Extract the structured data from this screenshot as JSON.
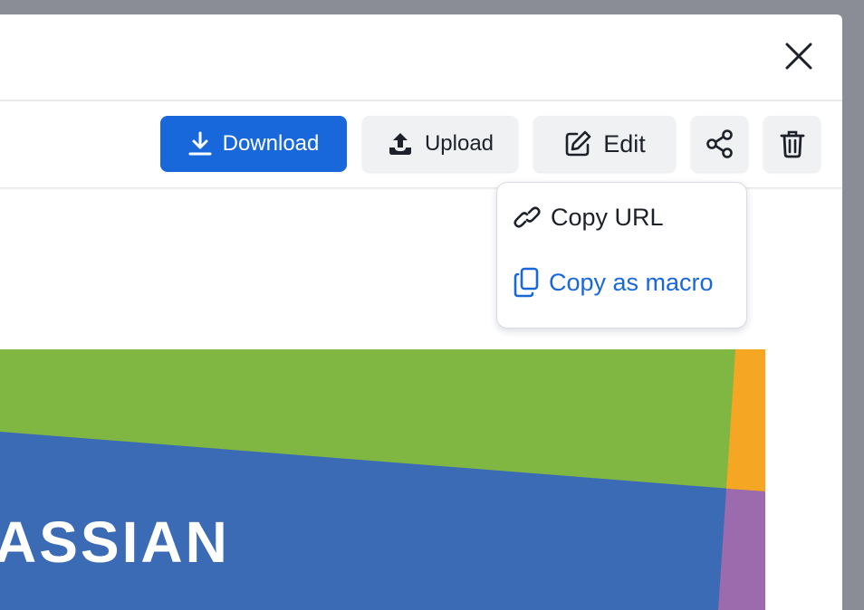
{
  "toolbar": {
    "download_label": "Download",
    "upload_label": "Upload",
    "edit_label": "Edit",
    "share_icon": "share-icon",
    "delete_icon": "trash-icon"
  },
  "share_menu": {
    "items": [
      {
        "label": "Copy URL",
        "icon": "link-icon"
      },
      {
        "label": "Copy as macro",
        "icon": "copy-icon"
      }
    ]
  },
  "preview": {
    "visible_text": "ASSIAN"
  },
  "colors": {
    "primary": "#1868db",
    "green": "#80b642",
    "blue": "#3b6bb5",
    "orange": "#f5a623",
    "purple": "#9b6bae"
  }
}
